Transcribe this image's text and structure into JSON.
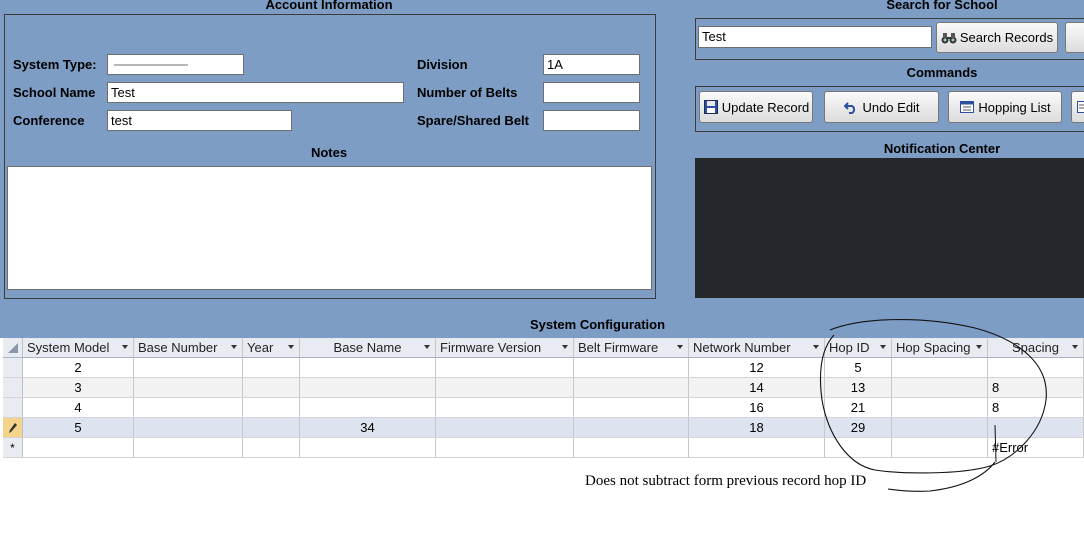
{
  "account": {
    "header": "Account Information",
    "system_type_label": "System Type:",
    "system_type_value": "",
    "school_name_label": "School Name",
    "school_name_value": "Test",
    "conference_label": "Conference",
    "conference_value": "test",
    "division_label": "Division",
    "division_value": "1A",
    "belts_label": "Number of Belts",
    "belts_value": "",
    "spare_label": "Spare/Shared Belt",
    "spare_value": "",
    "notes_label": "Notes",
    "notes_value": ""
  },
  "search": {
    "header": "Search for School",
    "value": "Test",
    "button_label": "Search Records"
  },
  "commands": {
    "header": "Commands",
    "update_label": "Update Record",
    "undo_label": "Undo Edit",
    "hopping_label": "Hopping List"
  },
  "notification": {
    "header": "Notification Center"
  },
  "grid": {
    "title": "System Configuration",
    "columns": [
      "System Model",
      "Base Number",
      "Year",
      "Base Name",
      "Firmware Version",
      "Belt Firmware",
      "Network Number",
      "Hop ID",
      "Hop Spacing",
      "Spacing"
    ],
    "rows": [
      [
        "2",
        "",
        "",
        "",
        "",
        "",
        "12",
        "5",
        "",
        ""
      ],
      [
        "3",
        "",
        "",
        "",
        "",
        "",
        "14",
        "13",
        "",
        "8"
      ],
      [
        "4",
        "",
        "",
        "",
        "",
        "",
        "16",
        "21",
        "",
        "8"
      ],
      [
        "5",
        "",
        "",
        "34",
        "",
        "",
        "18",
        "29",
        "",
        ""
      ]
    ],
    "new_row_marker": "*",
    "new_row_error": "#Error"
  },
  "annotation": "Does not subtract form previous record hop ID"
}
